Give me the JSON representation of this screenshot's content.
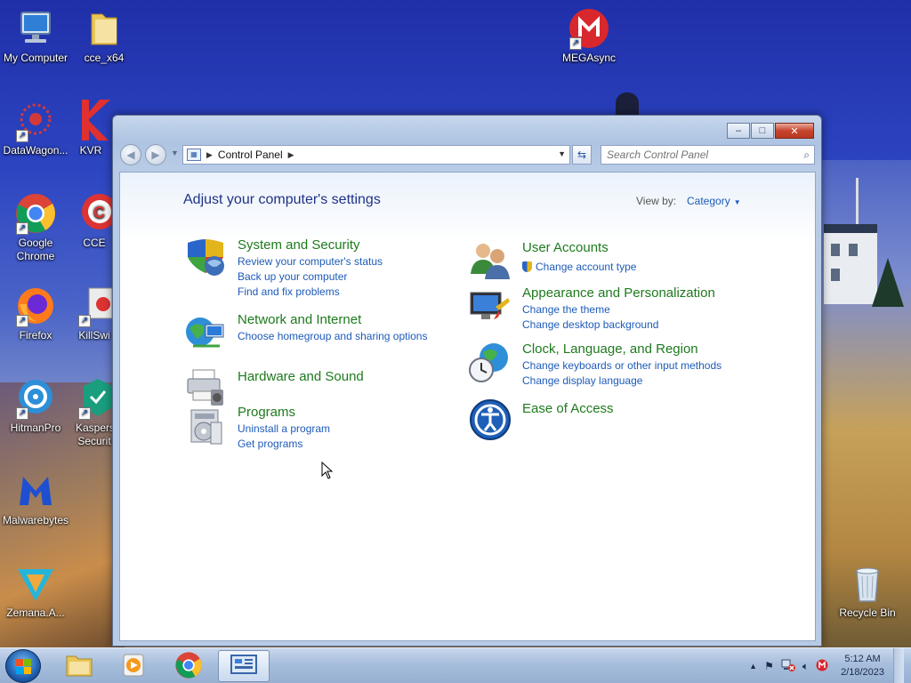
{
  "desktop": {
    "icons": [
      {
        "label": "My Computer",
        "icon": "computer-icon"
      },
      {
        "label": "cce_x64",
        "icon": "folder-icon"
      },
      {
        "label": "MEGAsync",
        "icon": "megasync-icon"
      },
      {
        "label": "DataWagon...",
        "icon": "datawagon-icon"
      },
      {
        "label": "KVR",
        "icon": "kvrt-icon"
      },
      {
        "label": "Google Chrome",
        "icon": "chrome-icon"
      },
      {
        "label": "CCE",
        "icon": "cce-icon"
      },
      {
        "label": "Firefox",
        "icon": "firefox-icon"
      },
      {
        "label": "KillSwi",
        "icon": "killswitch-icon"
      },
      {
        "label": "HitmanPro",
        "icon": "hitmanpro-icon"
      },
      {
        "label": "Kaspers Securit",
        "icon": "kaspersky-icon"
      },
      {
        "label": "Malwarebytes",
        "icon": "malwarebytes-icon"
      },
      {
        "label": "Zemana.A...",
        "icon": "zemana-icon"
      },
      {
        "label": "Recycle Bin",
        "icon": "recycle-bin-icon"
      }
    ]
  },
  "window": {
    "controls": {
      "minimize": "–",
      "maximize": "□",
      "close": "✕"
    },
    "address": {
      "crumb": "Control Panel"
    },
    "search": {
      "placeholder": "Search Control Panel"
    },
    "heading": "Adjust your computer's settings",
    "view_by": {
      "label": "View by:",
      "value": "Category"
    },
    "categories": [
      {
        "title": "System and Security",
        "icon": "shield-icon",
        "links": [
          "Review your computer's status",
          "Back up your computer",
          "Find and fix problems"
        ]
      },
      {
        "title": "Network and Internet",
        "icon": "network-globe-icon",
        "links": [
          "Choose homegroup and sharing options"
        ]
      },
      {
        "title": "Hardware and Sound",
        "icon": "printer-icon",
        "links": []
      },
      {
        "title": "Programs",
        "icon": "programs-icon",
        "links": [
          "Uninstall a program",
          "Get programs"
        ]
      },
      {
        "title": "User Accounts",
        "icon": "users-icon",
        "links": [
          "Change account type"
        ]
      },
      {
        "title": "Appearance and Personalization",
        "icon": "monitor-brush-icon",
        "links": [
          "Change the theme",
          "Change desktop background"
        ]
      },
      {
        "title": "Clock, Language, and Region",
        "icon": "clock-globe-icon",
        "links": [
          "Change keyboards or other input methods",
          "Change display language"
        ]
      },
      {
        "title": "Ease of Access",
        "icon": "ease-of-access-icon",
        "links": []
      }
    ]
  },
  "taskbar": {
    "items": [
      {
        "name": "explorer",
        "icon": "file-explorer-icon"
      },
      {
        "name": "media-player",
        "icon": "media-player-icon"
      },
      {
        "name": "chrome",
        "icon": "chrome-icon"
      },
      {
        "name": "control-panel",
        "icon": "control-panel-icon",
        "active": true
      }
    ],
    "clock": {
      "time": "5:12 AM",
      "date": "2/18/2023"
    },
    "tray": {
      "show_hidden": "▲"
    }
  }
}
